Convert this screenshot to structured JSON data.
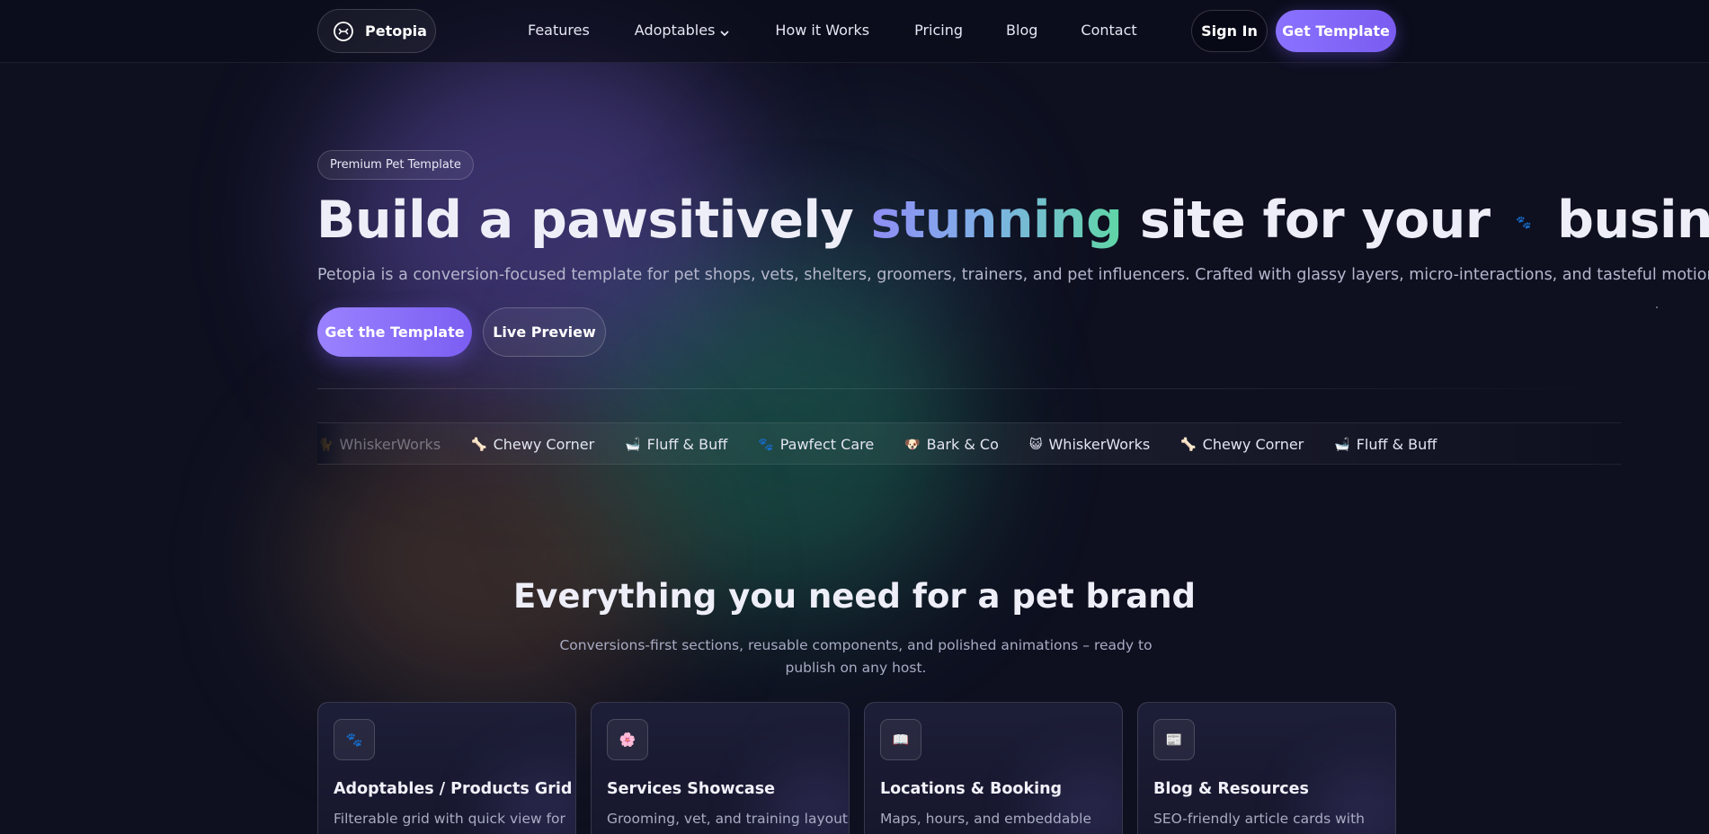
{
  "header": {
    "brand": "Petopia",
    "nav": [
      {
        "label": "Features"
      },
      {
        "label": "Adoptables"
      },
      {
        "label": "How it Works"
      },
      {
        "label": "Pricing"
      },
      {
        "label": "Blog"
      },
      {
        "label": "Contact"
      }
    ],
    "sign_in": "Sign In",
    "get_template": "Get Template"
  },
  "hero": {
    "badge": "Premium Pet Template",
    "title_prefix": "Build a pawsitively",
    "title_highlight": "stunning",
    "title_middle": "site for your",
    "title_icon": "🐾",
    "title_suffix": "business",
    "subtitle": "Petopia is a conversion-focused template for pet shops, vets, shelters, groomers, trainers, and pet influencers. Crafted with glassy layers, micro-interactions, and tasteful motion.",
    "cta_primary": "Get the Template",
    "cta_secondary": "Live Preview"
  },
  "marquee": {
    "items": [
      {
        "icon": "🐈",
        "label": "WhiskerWorks"
      },
      {
        "icon": "🦴",
        "label": "Chewy Corner"
      },
      {
        "icon": "🛁",
        "label": "Fluff & Buff"
      },
      {
        "icon": "🐾",
        "label": "Pawfect Care"
      },
      {
        "icon": "🐶",
        "label": "Bark & Co"
      },
      {
        "icon": "😺",
        "label": "WhiskerWorks"
      },
      {
        "icon": "🦴",
        "label": "Chewy Corner"
      },
      {
        "icon": "🛁",
        "label": "Fluff & Buff"
      }
    ]
  },
  "features": {
    "title": "Everything you need for a pet brand",
    "subtitle": "Conversions-first sections, reusable components, and polished animations – ready to publish on any host.",
    "cards": [
      {
        "icon": "🐾",
        "title": "Adoptables / Products Grid",
        "desc": "Filterable grid with quick view for"
      },
      {
        "icon": "🌸",
        "title": "Services Showcase",
        "desc": "Grooming, vet, and training layouts"
      },
      {
        "icon": "📖",
        "title": "Locations & Booking",
        "desc": "Maps, hours, and embeddable"
      },
      {
        "icon": "📰",
        "title": "Blog & Resources",
        "desc": "SEO-friendly article cards with"
      }
    ]
  },
  "colors": {
    "background": "#0e1020",
    "accent": "#8a72ff",
    "gradient_start": "#8f8df5",
    "gradient_end": "#5fd6a6"
  }
}
